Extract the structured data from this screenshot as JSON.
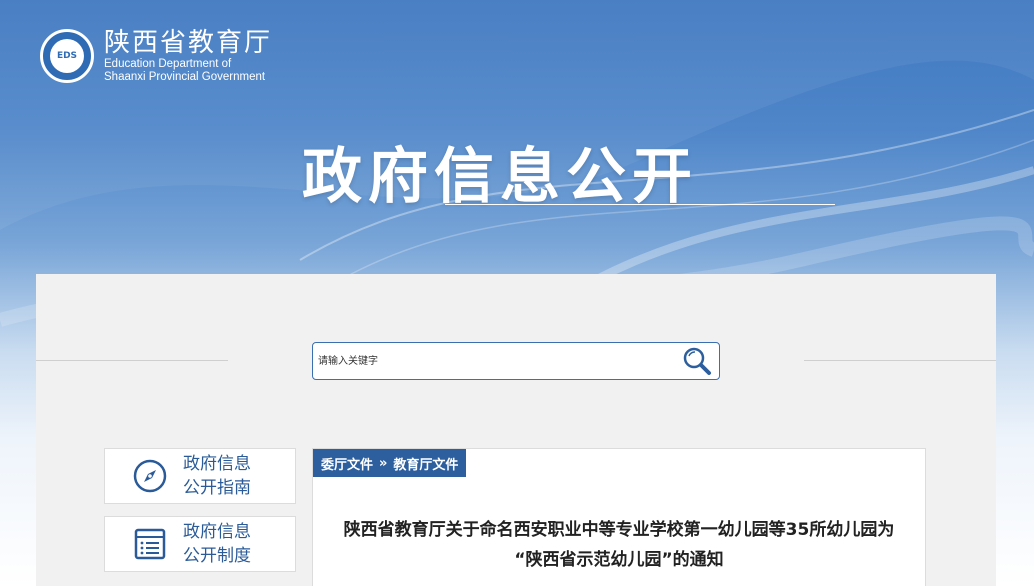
{
  "header": {
    "org_name_cn": "陕西省教育厅",
    "org_name_en_line1": "Education Department of",
    "org_name_en_line2": "Shaanxi Provincial Government",
    "emblem_text": "EDS",
    "headline": "政府信息公开"
  },
  "search": {
    "placeholder": "请输入关键字",
    "icon": "search-icon"
  },
  "sidebar": {
    "items": [
      {
        "line1": "政府信息",
        "line2": "公开指南",
        "icon": "compass-icon"
      },
      {
        "line1": "政府信息",
        "line2": "公开制度",
        "icon": "list-icon"
      }
    ]
  },
  "breadcrumb": {
    "items": [
      "委厅文件",
      "教育厅文件"
    ],
    "separator": "»"
  },
  "document": {
    "title_line1": "陕西省教育厅关于命名西安职业中等专业学校第一幼儿园等35所幼儿园为",
    "title_line2": "“陕西省示范幼儿园”的通知"
  },
  "colors": {
    "brand_blue": "#2d5f9e",
    "link_blue": "#2a5b98",
    "panel_bg": "#f1f1f1"
  }
}
